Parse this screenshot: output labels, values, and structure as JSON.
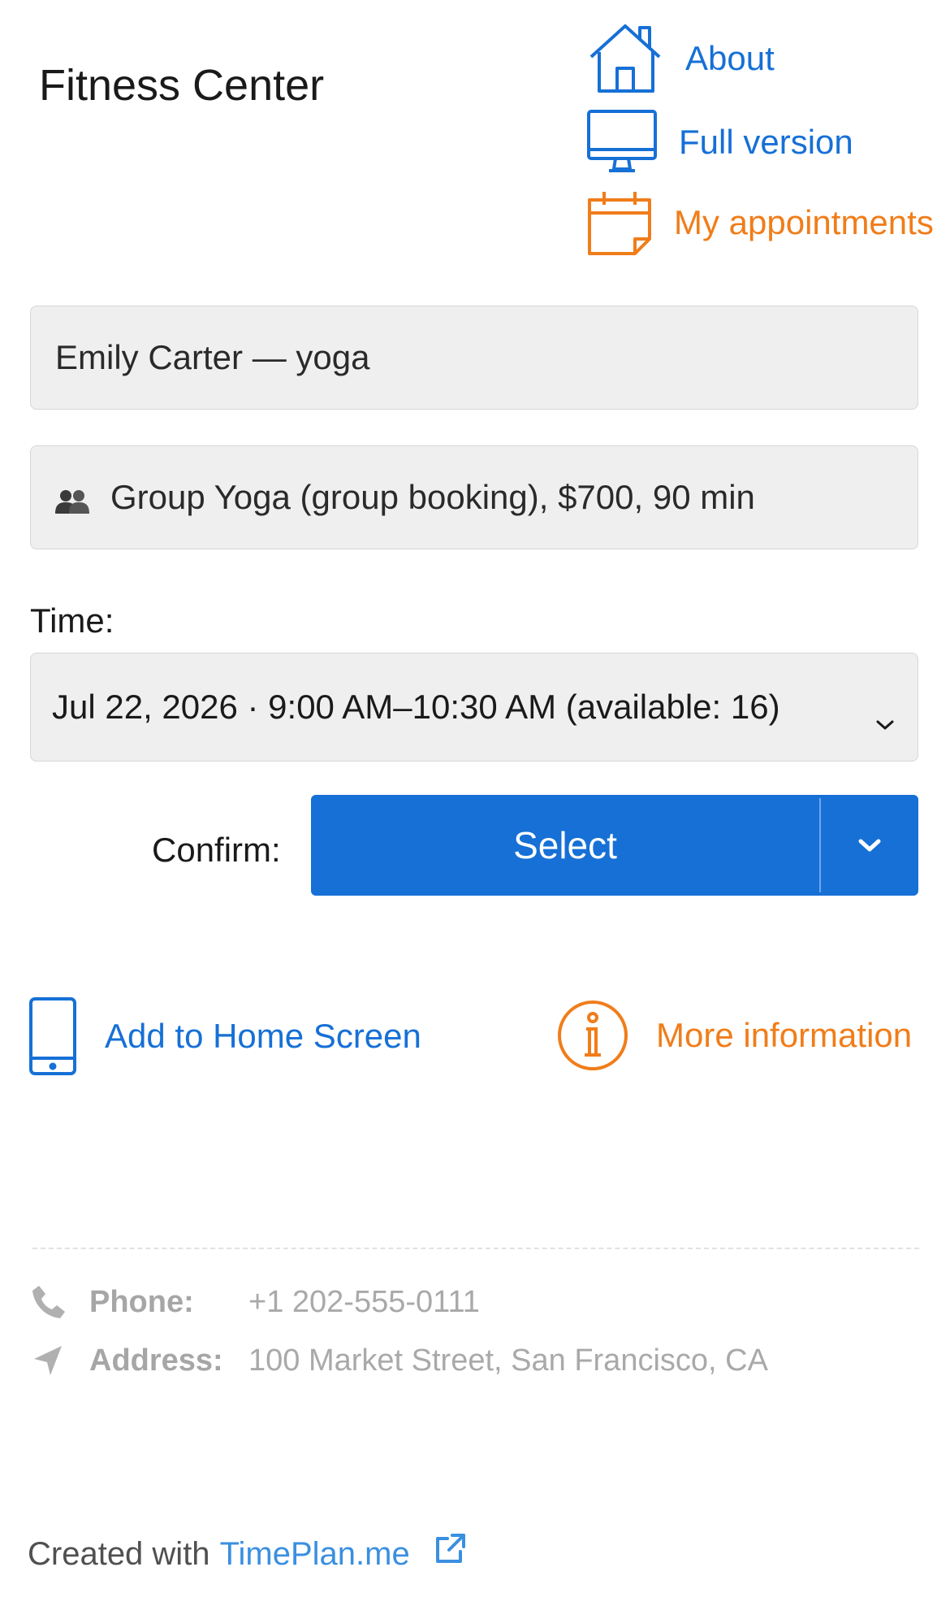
{
  "header": {
    "title": "Fitness Center",
    "nav": {
      "about": {
        "label": "About",
        "icon": "home-icon"
      },
      "full_version": {
        "label": "Full version",
        "icon": "monitor-icon"
      },
      "my_appointments": {
        "label": "My appointments",
        "icon": "calendar-icon"
      }
    }
  },
  "booking": {
    "provider": "Emily Carter — yoga",
    "service": "Group Yoga (group booking), $700, 90 min",
    "service_icon": "group-icon",
    "time_label": "Time:",
    "time_value": "Jul 22, 2026 · 9:00 AM–10:30 AM (available: 16)",
    "confirm_label": "Confirm:",
    "select_button": "Select"
  },
  "actions": {
    "add_home": {
      "label": "Add to Home Screen",
      "icon": "phone-icon"
    },
    "more_info": {
      "label": "More information",
      "icon": "info-icon"
    }
  },
  "contact": {
    "phone_key": "Phone:",
    "phone_value": "+1 202-555-0111",
    "address_key": "Address:",
    "address_value": "100 Market Street, San Francisco, CA"
  },
  "footer": {
    "created_with": "Created with",
    "link": "TimePlan.me"
  },
  "colors": {
    "accent_blue": "#1670d6",
    "accent_orange": "#f07d1a",
    "field_bg": "#efefef"
  }
}
